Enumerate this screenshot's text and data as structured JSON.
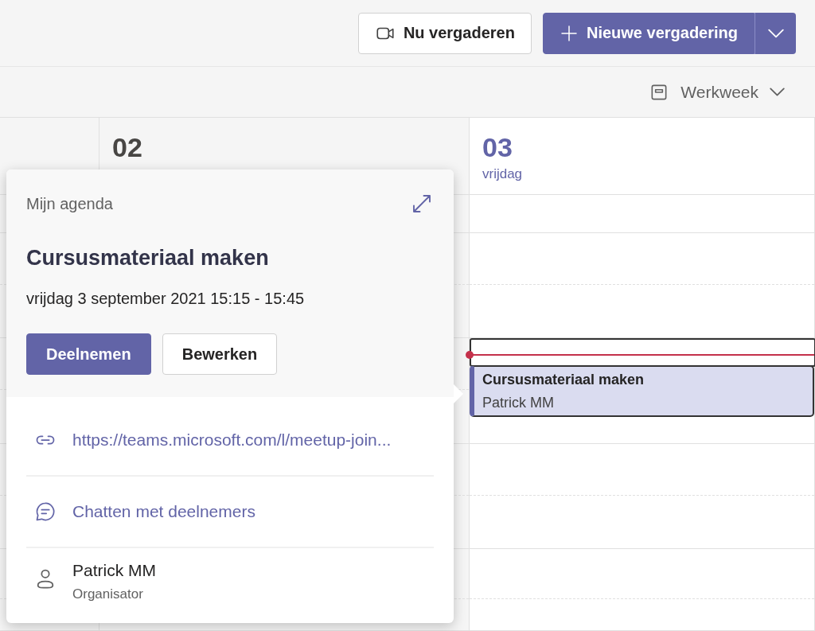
{
  "toolbar": {
    "buttons": [
      {
        "label": "Nu vergaderen",
        "kind": "secondary"
      },
      {
        "label": "Nieuwe vergadering",
        "kind": "primary"
      }
    ]
  },
  "view_switcher": {
    "label": "Werkweek"
  },
  "days": [
    {
      "number": "02",
      "selected": false
    },
    {
      "number": "03",
      "weekday": "vrijdag",
      "selected": true,
      "events": [
        {
          "title": "Cursusmateriaal maken",
          "organizer": "Patrick MM"
        }
      ]
    }
  ],
  "popup": {
    "calendar": "Mijn agenda",
    "title": "Cursusmateriaal maken",
    "when": "vrijdag 3 september 2021 15:15 - 15:45",
    "buttons": [
      {
        "label": "Deelnemen",
        "kind": "primary"
      },
      {
        "label": "Bewerken",
        "kind": "secondary"
      }
    ],
    "details": [
      {
        "kind": "link",
        "text": "https://teams.microsoft.com/l/meetup-join..."
      },
      {
        "kind": "chat",
        "text": "Chatten met deelnemers"
      },
      {
        "kind": "person",
        "name": "Patrick MM",
        "role": "Organisator"
      }
    ]
  }
}
